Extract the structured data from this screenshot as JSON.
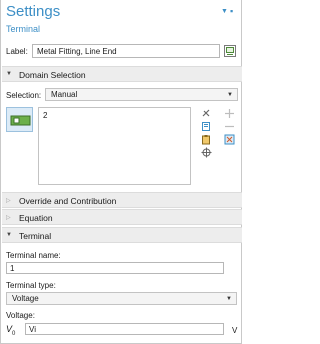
{
  "header": {
    "title": "Settings",
    "subtitle": "Terminal"
  },
  "label_field": {
    "label": "Label:",
    "value": "Metal Fitting, Line End"
  },
  "sections": {
    "domain_selection": "Domain Selection",
    "override": "Override and Contribution",
    "equation": "Equation",
    "terminal": "Terminal"
  },
  "selection": {
    "label": "Selection:",
    "value": "Manual",
    "items": [
      "2"
    ]
  },
  "terminal": {
    "name_label": "Terminal name:",
    "name_value": "1",
    "type_label": "Terminal type:",
    "type_value": "Voltage",
    "voltage_label": "Voltage:",
    "voltage_symbol": "V",
    "voltage_subscript": "0",
    "voltage_value": "Vi",
    "voltage_unit": "V"
  },
  "icons": {
    "pin": "pin-icon",
    "collapse": "collapse-arrow-icon",
    "expand": "expand-arrow-icon",
    "domain": "domain-selection-icon",
    "paste": "paste-selection-icon",
    "copy": "copy-selection-icon",
    "clear": "clear-selection-icon",
    "zoom": "zoom-to-selection-icon",
    "add": "add-icon",
    "remove": "remove-icon",
    "active": "active-toggle-icon",
    "edit": "edit-label-icon"
  },
  "colors": {
    "accent": "#3d8fc6",
    "section_bg": "#ededed"
  }
}
